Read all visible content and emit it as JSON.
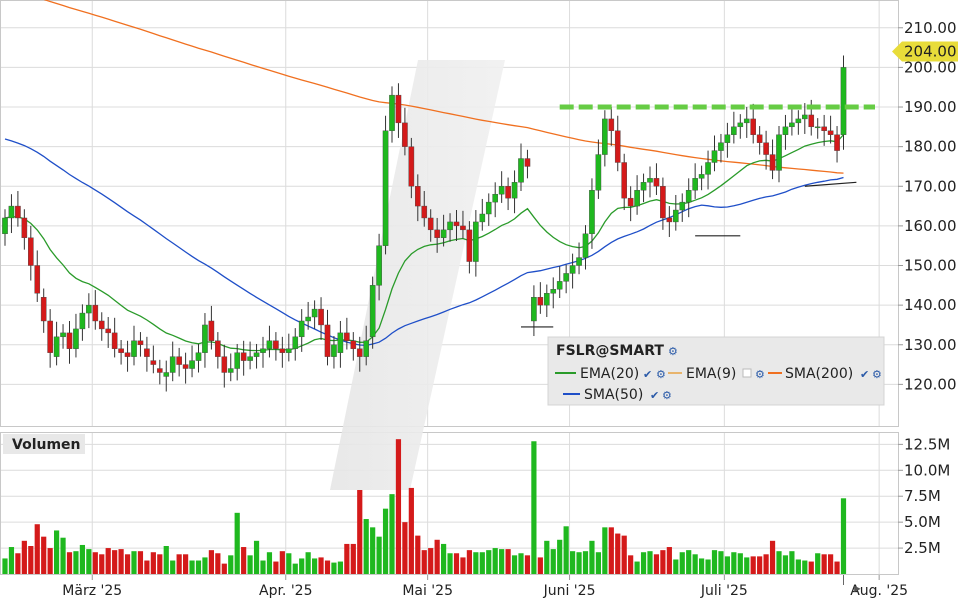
{
  "chart_data": {
    "type": "candlestick",
    "symbol": "FSLR@SMART",
    "last_price_label": "204.00",
    "price_axis": {
      "ticks": [
        "120.00",
        "130.00",
        "140.00",
        "150.00",
        "160.00",
        "170.00",
        "180.00",
        "190.00",
        "200.00",
        "210.00"
      ],
      "ylim": [
        110,
        216
      ]
    },
    "volume_panel": {
      "title": "Volumen",
      "ticks": [
        "2.5M",
        "5.0M",
        "7.5M",
        "10.0M",
        "12.5M"
      ],
      "ylim": [
        0,
        13.5
      ]
    },
    "x_ticks": [
      {
        "label": "März '25",
        "bar": 5
      },
      {
        "label": "Apr. '25",
        "bar": 35
      },
      {
        "label": "Mai '25",
        "bar": 57
      },
      {
        "label": "Juni '25",
        "bar": 79
      },
      {
        "label": "Juli '25",
        "bar": 103
      },
      {
        "label": "Aug. '25",
        "bar": 127
      }
    ],
    "legend": [
      {
        "name": "EMA(20)",
        "color": "#2a9b2a"
      },
      {
        "name": "EMA(9)",
        "color": "#e8b46c"
      },
      {
        "name": "SMA(200)",
        "color": "#f07020"
      },
      {
        "name": "SMA(50)",
        "color": "#1f4fc8"
      }
    ],
    "colors": {
      "up": "#1fb81f",
      "down": "#d41a1a",
      "grid": "#dcdcdc",
      "resistance": "#66cc44",
      "price_tag": "#e8dc3a"
    },
    "resistance_level": 190,
    "close": [
      162,
      165,
      162,
      157,
      150,
      143,
      136,
      128,
      132,
      133,
      129,
      134,
      138,
      140,
      136,
      134,
      133,
      129,
      128,
      127,
      131,
      130,
      127,
      125,
      123,
      123,
      127,
      125,
      124,
      126,
      128,
      135,
      131,
      127,
      123,
      124,
      128,
      126,
      127,
      128,
      129,
      131,
      129,
      128,
      129,
      132,
      136,
      137,
      139,
      135,
      127,
      130,
      133,
      131,
      129,
      127,
      131,
      145,
      155,
      184,
      193,
      186,
      180,
      170,
      165,
      162,
      159,
      157,
      159,
      161,
      160,
      159,
      151,
      161,
      163,
      166,
      168,
      170,
      167,
      171,
      177,
      175,
      142,
      140,
      143,
      144,
      146,
      148,
      150,
      152,
      158,
      169,
      178,
      187,
      184,
      176,
      167,
      165,
      169,
      171,
      172,
      170,
      162,
      161,
      164,
      166,
      169,
      172,
      173,
      176,
      179,
      181,
      183,
      185,
      186,
      187,
      183,
      181,
      178,
      174,
      183,
      185,
      186,
      187,
      188,
      185,
      185,
      184,
      183,
      179,
      200
    ],
    "open": [
      158,
      162,
      165,
      162,
      157,
      150,
      142,
      136,
      127,
      132,
      133,
      129,
      134,
      138,
      140,
      136,
      134,
      133,
      129,
      128,
      127,
      131,
      129,
      126,
      124,
      122,
      123,
      127,
      125,
      124,
      126,
      128,
      136,
      131,
      127,
      123,
      124,
      128,
      126,
      127,
      128,
      129,
      131,
      129,
      128,
      129,
      132,
      136,
      137,
      139,
      135,
      127,
      128,
      133,
      131,
      129,
      127,
      132,
      145,
      155,
      184,
      193,
      186,
      180,
      170,
      165,
      162,
      159,
      157,
      159,
      161,
      160,
      159,
      151,
      161,
      163,
      166,
      168,
      170,
      167,
      171,
      177,
      136,
      142,
      140,
      143,
      144,
      146,
      148,
      150,
      152,
      158,
      169,
      178,
      187,
      184,
      176,
      167,
      165,
      169,
      171,
      172,
      170,
      162,
      161,
      164,
      166,
      169,
      172,
      173,
      176,
      179,
      181,
      183,
      185,
      186,
      187,
      183,
      181,
      178,
      174,
      183,
      185,
      186,
      187,
      188,
      185,
      185,
      184,
      183,
      183
    ],
    "volume": [
      1.5,
      2.6,
      2.0,
      3.2,
      2.7,
      4.8,
      3.6,
      2.5,
      4.2,
      3.5,
      2.1,
      2.2,
      2.8,
      2.4,
      2.1,
      1.9,
      2.5,
      2.3,
      2.4,
      1.9,
      2.2,
      2.2,
      1.3,
      2.1,
      1.9,
      2.7,
      1.3,
      1.9,
      1.9,
      1.3,
      1.3,
      1.6,
      2.3,
      2.0,
      1.0,
      1.8,
      5.9,
      2.6,
      1.8,
      3.2,
      1.3,
      2.1,
      1.2,
      2.2,
      2.0,
      1.0,
      1.5,
      2.1,
      1.5,
      1.6,
      1.3,
      1.1,
      1.2,
      2.9,
      2.9,
      8.1,
      5.3,
      4.5,
      3.6,
      6.3,
      7.7,
      13.0,
      5.0,
      8.3,
      3.7,
      2.3,
      2.5,
      3.3,
      2.9,
      2.0,
      2.0,
      1.6,
      2.3,
      2.1,
      2.1,
      2.3,
      2.5,
      2.4,
      2.4,
      1.8,
      2.0,
      1.8,
      12.8,
      1.6,
      3.2,
      2.4,
      3.3,
      4.6,
      2.2,
      2.1,
      2.2,
      3.2,
      2.1,
      4.5,
      4.5,
      3.9,
      3.7,
      1.8,
      1.2,
      2.1,
      2.2,
      1.9,
      2.3,
      2.6,
      1.4,
      2.1,
      2.3,
      1.9,
      1.5,
      1.4,
      2.3,
      2.2,
      1.7,
      2.1,
      2.0,
      1.6,
      1.7,
      1.7,
      1.9,
      3.2,
      2.2,
      1.8,
      2.2,
      1.4,
      1.3,
      1.2,
      2.0,
      1.9,
      1.9,
      1.2,
      7.3
    ],
    "annotations": [
      {
        "type": "support",
        "x0": 80,
        "x1": 85,
        "y": 134.5
      },
      {
        "type": "support",
        "x0": 107,
        "x1": 114,
        "y": 157.5
      },
      {
        "type": "trend",
        "x0": 124,
        "x1": 132,
        "y0": 170,
        "y1": 171
      }
    ]
  },
  "ui": {
    "legend_gear_icon": "gear-icon",
    "legend_check_icon": "check-icon",
    "volume_scroll_icon": "arrow-right-icon"
  }
}
